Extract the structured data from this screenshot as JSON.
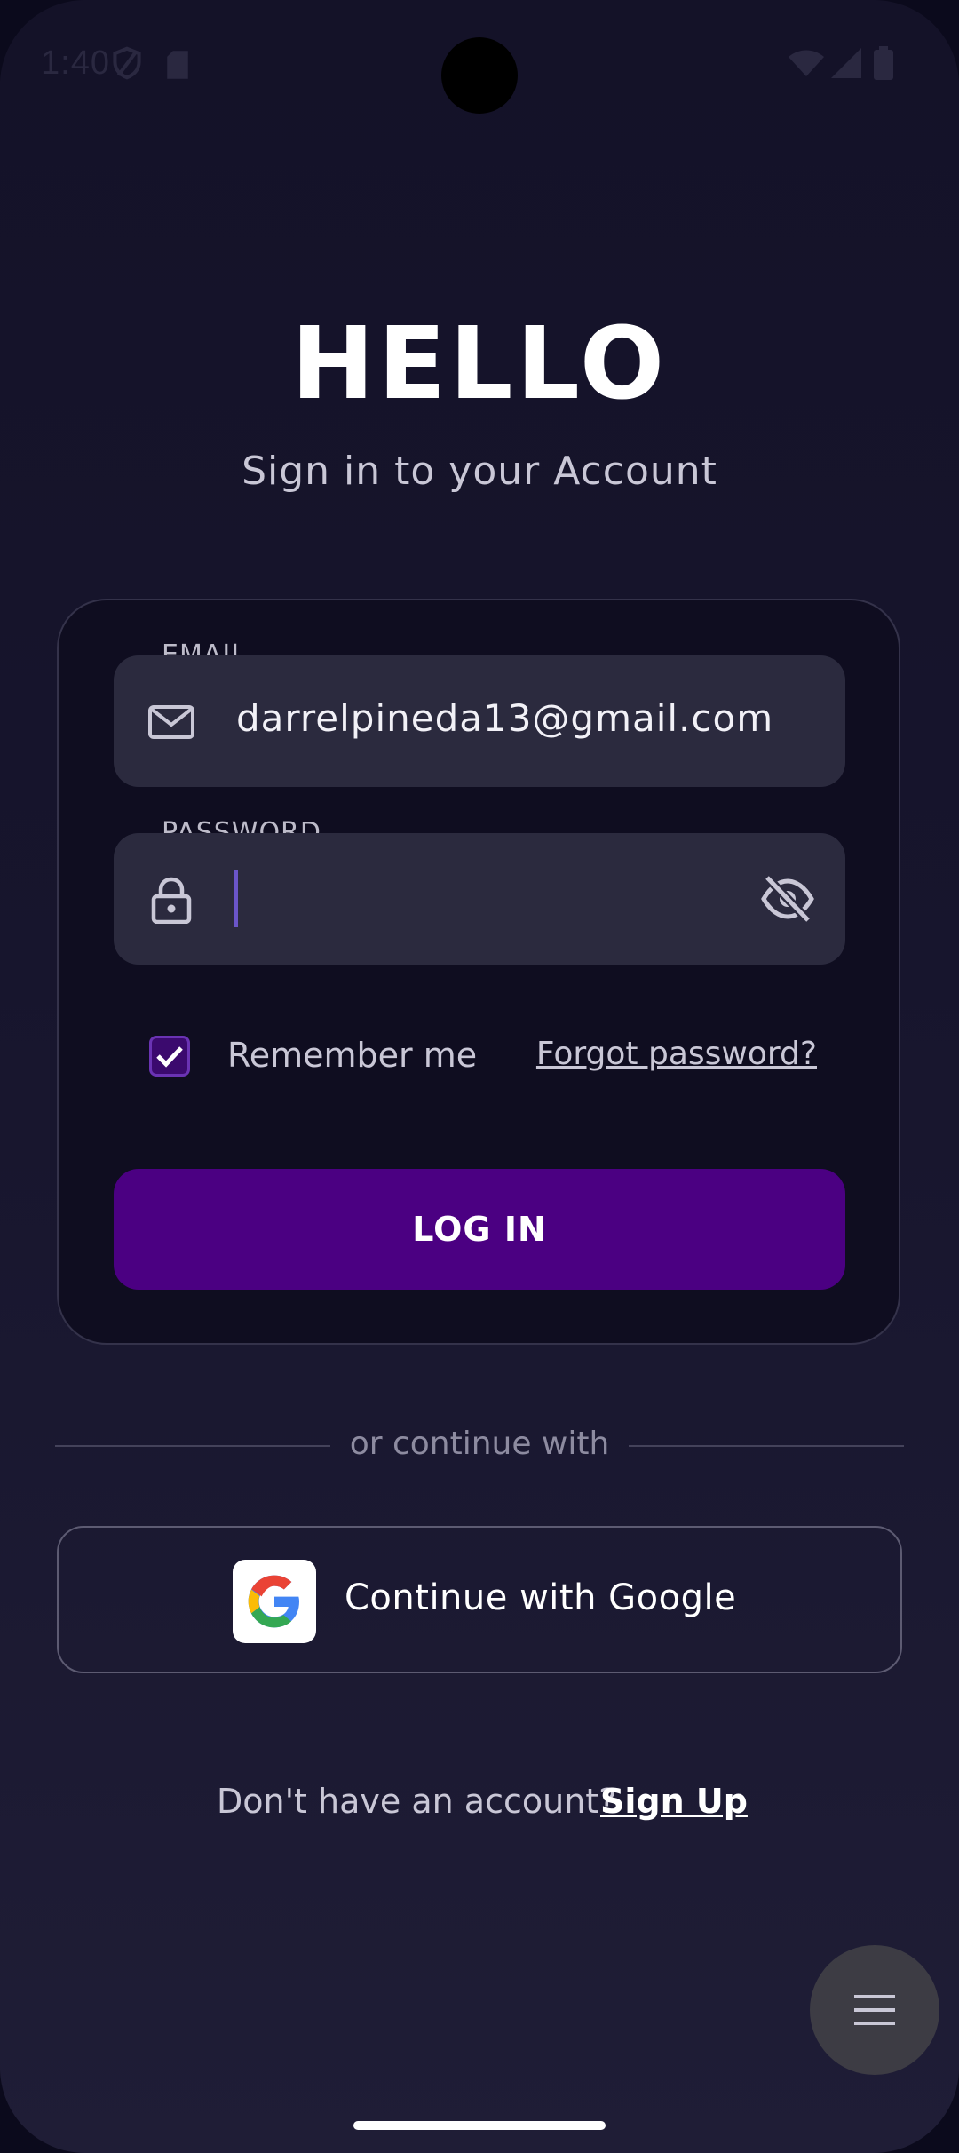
{
  "status_bar": {
    "time": "1:40",
    "icons": [
      "shield-icon",
      "sim-card-icon",
      "wifi-icon",
      "signal-icon",
      "battery-icon"
    ]
  },
  "header": {
    "title": "HELLO",
    "subtitle": "Sign in to your Account"
  },
  "login_form": {
    "email_label": "EMAIL",
    "email_value": "darrelpineda13@gmail.com",
    "password_label": "PASSWORD",
    "password_value": "",
    "remember_label": "Remember me",
    "remember_checked": true,
    "forgot_link": "Forgot password?",
    "login_button": "LOG IN"
  },
  "divider_text": "or continue with",
  "google_button": "Continue with Google",
  "signup": {
    "prompt": "Don't have an account?",
    "link": "Sign Up"
  },
  "colors": {
    "accent": "#4b0082",
    "background": "#17152d",
    "field": "#2b2a3e"
  }
}
